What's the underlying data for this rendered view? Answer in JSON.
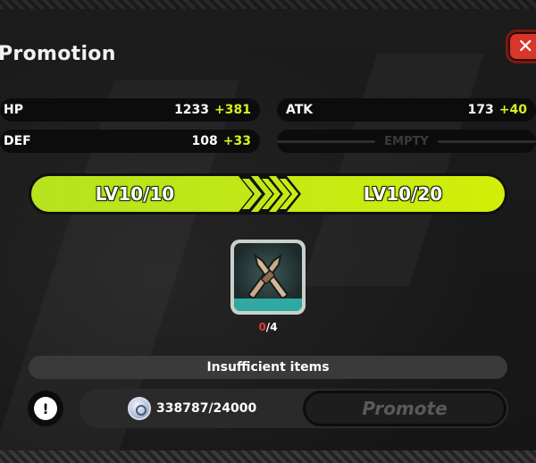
{
  "header": {
    "title": "Promotion",
    "close_label": "✕"
  },
  "stats": {
    "hp": {
      "label": "HP",
      "base": "1233",
      "bonus": "+381"
    },
    "atk": {
      "label": "ATK",
      "base": "173",
      "bonus": "+40"
    },
    "def": {
      "label": "DEF",
      "base": "108",
      "bonus": "+33"
    },
    "empty": {
      "label": "EMPTY"
    }
  },
  "level": {
    "current": "LV10/10",
    "next": "LV10/20"
  },
  "material": {
    "icon": "crossed-blades-icon",
    "have": "0",
    "separator": "/",
    "need": "4"
  },
  "warning": {
    "text": "Insufficient items"
  },
  "cost": {
    "icon": "silver-coin-icon",
    "text": "338787/24000"
  },
  "actions": {
    "info_label": "!",
    "promote_label": "Promote"
  },
  "colors": {
    "accent": "#c4ea14",
    "bonus_text": "#d8f01c",
    "insufficient": "#e03a2a",
    "close": "#d9352b"
  }
}
